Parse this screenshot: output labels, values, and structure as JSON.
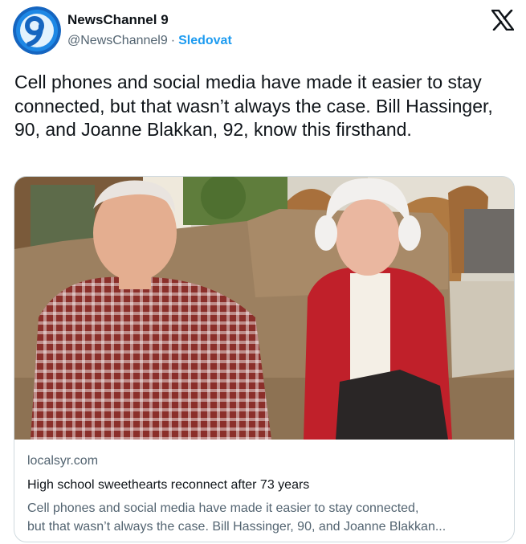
{
  "account": {
    "display_name": "NewsChannel 9",
    "handle": "@NewsChannel9",
    "separator": "·",
    "follow_label": "Sledovat"
  },
  "tweet": {
    "text": "Cell phones and social media have made it easier to stay connected, but that wasn’t always the case. Bill Hassinger, 90, and Joanne Blakkan, 92, know this firsthand."
  },
  "card": {
    "domain": "localsyr.com",
    "title": "High school sweethearts reconnect after 73 years",
    "description_line1": "Cell phones and social media have made it easier to stay connected,",
    "description_line2": "but that wasn’t always the case. Bill Hassinger, 90, and Joanne Blakkan..."
  },
  "colors": {
    "accent": "#1d9bf0",
    "avatar_blue": "#1565c0",
    "text_primary": "#0f1419",
    "text_secondary": "#536471"
  },
  "icons": {
    "avatar": "newschannel9-logo",
    "platform": "x-logo-icon"
  }
}
